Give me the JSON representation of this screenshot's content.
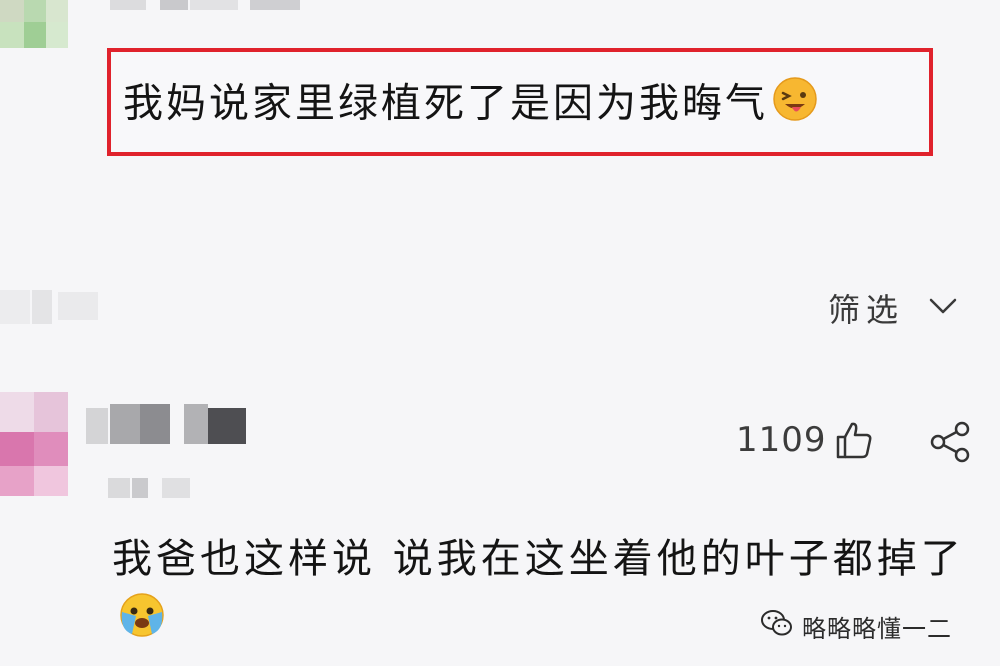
{
  "highlighted_comment": {
    "text": "我妈说家里绿植死了是因为我晦气",
    "emoji": "tongue-wink-emoji"
  },
  "filter": {
    "label": "筛选",
    "icon": "chevron-down-icon"
  },
  "comment": {
    "like_count": "1109",
    "like_icon": "thumbs-up-icon",
    "share_icon": "share-icon",
    "text": "我爸也这样说 说我在这坐着他的叶子都掉了",
    "emoji": "crying-emoji"
  },
  "watermark": {
    "text": "略略略懂一二",
    "icon": "wechat-logo-icon"
  },
  "colors": {
    "highlight_border": "#e0222c",
    "background": "#f6f6f8"
  }
}
